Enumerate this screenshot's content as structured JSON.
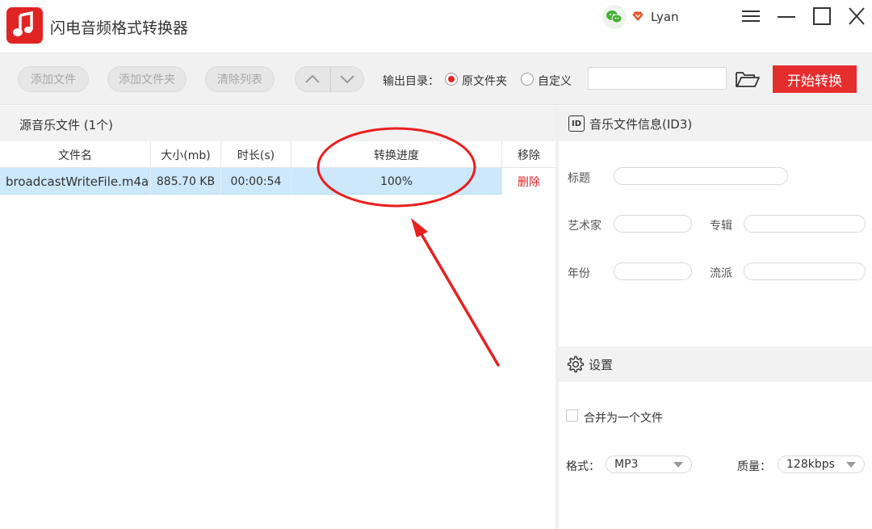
{
  "app": {
    "title": "闪电音频格式转换器",
    "user_name": "Lyan",
    "accent_color": "#e52d2d"
  },
  "toolbar": {
    "add_file": "添加文件",
    "add_folder": "添加文件夹",
    "clear_list": "清除列表",
    "output_label": "输出目录：",
    "radio_source_label": "原文件夹",
    "radio_custom_label": "自定义",
    "selected_output": "原文件夹",
    "path_value": "",
    "start_label": "开始转换"
  },
  "file_list": {
    "title": "源音乐文件 (1个)",
    "columns": [
      "文件名",
      "大小(mb)",
      "时长(s)",
      "转换进度",
      "移除"
    ],
    "rows": [
      {
        "name": "broadcastWriteFile.m4a",
        "size": "885.70 KB",
        "duration": "00:00:54",
        "progress": "100%",
        "remove": "删除"
      }
    ]
  },
  "id3": {
    "title": "音乐文件信息(ID3)",
    "id_badge": "ID",
    "fields": {
      "title_label": "标题",
      "artist_label": "艺术家",
      "album_label": "专辑",
      "year_label": "年份",
      "genre_label": "流派",
      "title_value": "",
      "artist_value": "",
      "album_value": "",
      "year_value": "",
      "genre_value": ""
    }
  },
  "settings": {
    "title": "设置",
    "merge_label": "合并为一个文件",
    "merge_checked": false,
    "format_label": "格式：",
    "format_value": "MP3",
    "quality_label": "质量：",
    "quality_value": "128kbps"
  },
  "annotation_color": "#e8201f"
}
